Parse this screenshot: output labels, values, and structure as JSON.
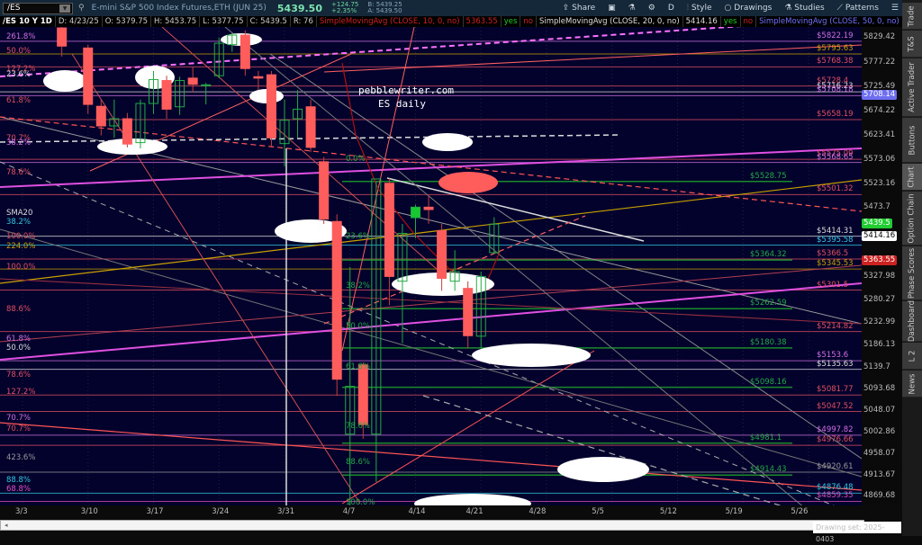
{
  "header": {
    "symbol": "/ES",
    "description": "E-mini S&P 500 Index Futures,ETH (JUN 25)",
    "last": "5439.50",
    "change": "+124.75",
    "change_pct": "+2.35%",
    "bid": "B: 5439.25",
    "ask": "A: 5439.50",
    "tools": {
      "share": "Share",
      "period": "D",
      "style": "Style",
      "drawings": "Drawings",
      "studies": "Studies",
      "patterns": "Patterns"
    }
  },
  "infobar": {
    "period": "/ES 10 Y 1D",
    "date": "D: 4/23/25",
    "open": "O: 5379.75",
    "high": "H: 5453.75",
    "low": "L: 5377.75",
    "close": "C: 5439.5",
    "range": "R: 76",
    "sma10": "SimpleMovingAvg (CLOSE, 10, 0, no)",
    "sma10_val": "5363.55",
    "sma20": "SimpleMovingAvg (CLOSE, 20, 0, no)",
    "sma20_val": "5414.16",
    "sma50": "SimpleMovingAvg (CLOSE, 50, 0, no)",
    "sma50_val": "...",
    "yes": "yes",
    "no": "no"
  },
  "watermark": {
    "line1": "pebblewriter.com",
    "line2": "ES daily"
  },
  "chart": {
    "candles": [
      {
        "i": 3,
        "o": 5850,
        "h": 5870,
        "l": 5790,
        "c": 5812
      },
      {
        "i": 5,
        "o": 5808,
        "h": 5815,
        "l": 5670,
        "c": 5690
      },
      {
        "i": 6,
        "o": 5686,
        "h": 5700,
        "l": 5625,
        "c": 5645
      },
      {
        "i": 7,
        "o": 5645,
        "h": 5700,
        "l": 5620,
        "c": 5660
      },
      {
        "i": 8,
        "o": 5660,
        "h": 5672,
        "l": 5600,
        "c": 5607
      },
      {
        "i": 9,
        "o": 5610,
        "h": 5700,
        "l": 5598,
        "c": 5692
      },
      {
        "i": 10,
        "o": 5692,
        "h": 5760,
        "l": 5670,
        "c": 5742
      },
      {
        "i": 11,
        "o": 5740,
        "h": 5750,
        "l": 5660,
        "c": 5680
      },
      {
        "i": 12,
        "o": 5685,
        "h": 5748,
        "l": 5668,
        "c": 5740
      },
      {
        "i": 13,
        "o": 5745,
        "h": 5768,
        "l": 5715,
        "c": 5732
      },
      {
        "i": 14,
        "o": 5729,
        "h": 5735,
        "l": 5690,
        "c": 5731
      },
      {
        "i": 15,
        "o": 5750,
        "h": 5830,
        "l": 5745,
        "c": 5818
      },
      {
        "i": 16,
        "o": 5815,
        "h": 5840,
        "l": 5800,
        "c": 5835
      },
      {
        "i": 17,
        "o": 5835,
        "h": 5845,
        "l": 5750,
        "c": 5765
      },
      {
        "i": 18,
        "o": 5748,
        "h": 5760,
        "l": 5720,
        "c": 5745
      },
      {
        "i": 19,
        "o": 5752,
        "h": 5760,
        "l": 5600,
        "c": 5620
      },
      {
        "i": 20,
        "o": 5608,
        "h": 5700,
        "l": 5560,
        "c": 5657
      },
      {
        "i": 21,
        "o": 5660,
        "h": 5720,
        "l": 5620,
        "c": 5680
      },
      {
        "i": 22,
        "o": 5685,
        "h": 5700,
        "l": 5590,
        "c": 5600
      },
      {
        "i": 23,
        "o": 5570,
        "h": 5580,
        "l": 5440,
        "c": 5450
      },
      {
        "i": 24,
        "o": 5445,
        "h": 5460,
        "l": 5080,
        "c": 5115
      },
      {
        "i": 25,
        "o": 5000,
        "h": 5350,
        "l": 4832,
        "c": 5100
      },
      {
        "i": 26,
        "o": 5145,
        "h": 5150,
        "l": 4990,
        "c": 5020
      },
      {
        "i": 27,
        "o": 5000,
        "h": 5530,
        "l": 4900,
        "c": 5534
      },
      {
        "i": 28,
        "o": 5525,
        "h": 5535,
        "l": 5270,
        "c": 5330
      },
      {
        "i": 29,
        "o": 5320,
        "h": 5440,
        "l": 5190,
        "c": 5420
      },
      {
        "i": 30,
        "o": 5453,
        "h": 5480,
        "l": 5410,
        "c": 5475,
        "filled": true
      },
      {
        "i": 31,
        "o": 5475,
        "h": 5500,
        "l": 5440,
        "c": 5470
      },
      {
        "i": 32,
        "o": 5426,
        "h": 5440,
        "l": 5300,
        "c": 5326
      },
      {
        "i": 33,
        "o": 5320,
        "h": 5385,
        "l": 5300,
        "c": 5340
      },
      {
        "i": 34,
        "o": 5305,
        "h": 5320,
        "l": 5180,
        "c": 5206
      },
      {
        "i": 35,
        "o": 5205,
        "h": 5340,
        "l": 5180,
        "c": 5330
      },
      {
        "i": 36,
        "o": 5379.75,
        "h": 5453.75,
        "l": 5377.75,
        "c": 5439.5
      }
    ],
    "price_levels": [
      {
        "text": "$5822.19",
        "p": 5822.19,
        "color": "#d070e0"
      },
      {
        "text": "$5795.63",
        "p": 5795.63,
        "color": "#c8a000"
      },
      {
        "text": "$5768.38",
        "p": 5768.38,
        "color": "#e05060"
      },
      {
        "text": "$5728.4",
        "p": 5728.4,
        "color": "#e05060"
      },
      {
        "text": "$5716.23",
        "p": 5716.23,
        "color": "#dddddd"
      },
      {
        "text": "$5708.18",
        "p": 5708.18,
        "color": "#d070e0"
      },
      {
        "text": "$5658.19",
        "p": 5658.19,
        "color": "#e05060"
      },
      {
        "text": "$5575.09",
        "p": 5575.09,
        "color": "#e05060"
      },
      {
        "text": "$5568.65",
        "p": 5568.65,
        "color": "#d070e0"
      },
      {
        "text": "$5501.32",
        "p": 5501.32,
        "color": "#e05060"
      },
      {
        "text": "$5414.31",
        "p": 5414.31,
        "color": "#dddddd"
      },
      {
        "text": "$5395.58",
        "p": 5395.58,
        "color": "#30c8e0"
      },
      {
        "text": "$5366.5",
        "p": 5366.5,
        "color": "#e05060"
      },
      {
        "text": "$5345.53",
        "p": 5345.53,
        "color": "#c8a000"
      },
      {
        "text": "$5301.5",
        "p": 5301.5,
        "color": "#e05060"
      },
      {
        "text": "$5214.82",
        "p": 5214.82,
        "color": "#e05060"
      },
      {
        "text": "$5153.6",
        "p": 5153.6,
        "color": "#d070e0"
      },
      {
        "text": "$5135.63",
        "p": 5135.63,
        "color": "#dddddd"
      },
      {
        "text": "$5081.77",
        "p": 5081.77,
        "color": "#e05060"
      },
      {
        "text": "$5047.52",
        "p": 5047.52,
        "color": "#e05060"
      },
      {
        "text": "$4997.82",
        "p": 4997.82,
        "color": "#d070e0"
      },
      {
        "text": "$4976.66",
        "p": 4976.66,
        "color": "#e05060"
      },
      {
        "text": "$4920.61",
        "p": 4920.61,
        "color": "#999999"
      },
      {
        "text": "$4876.48",
        "p": 4876.48,
        "color": "#30c8e0"
      },
      {
        "text": "$4859.35",
        "p": 4859.35,
        "color": "#e050c0"
      }
    ],
    "green_levels": [
      {
        "text": "$5528.75",
        "p": 5528.75
      },
      {
        "text": "$5364.32",
        "p": 5364.32
      },
      {
        "text": "$5262.59",
        "p": 5262.59
      },
      {
        "text": "$5180.38",
        "p": 5180.38
      },
      {
        "text": "$5098.16",
        "p": 5098.16
      },
      {
        "text": "$4981.1",
        "p": 4981.1
      },
      {
        "text": "$4914.43",
        "p": 4914.43
      }
    ],
    "fib_left": [
      {
        "text": "261.8%",
        "p": 5820,
        "color": "#d070e0"
      },
      {
        "text": "50.0%",
        "p": 5790,
        "color": "#e05060"
      },
      {
        "text": "127.2%",
        "p": 5752,
        "color": "#e05060"
      },
      {
        "text": "23.6%",
        "p": 5741,
        "color": "#dddddd"
      },
      {
        "text": "61.8%",
        "p": 5686,
        "color": "#e05060"
      },
      {
        "text": "70.7%",
        "p": 5607,
        "color": "#e05060"
      },
      {
        "text": "38.2%",
        "p": 5598,
        "color": "#d070e0"
      },
      {
        "text": "78.6%",
        "p": 5536,
        "color": "#e05060"
      },
      {
        "text": "SMA20",
        "p": 5452,
        "color": "#dddddd"
      },
      {
        "text": "38.2%",
        "p": 5432,
        "color": "#30c8e0"
      },
      {
        "text": "100.0%",
        "p": 5402,
        "color": "#e05060"
      },
      {
        "text": "224.0%",
        "p": 5381,
        "color": "#c8a000"
      },
      {
        "text": "100.0%",
        "p": 5338,
        "color": "#e05060"
      },
      {
        "text": "88.6%",
        "p": 5250,
        "color": "#e05060"
      },
      {
        "text": "61.8%",
        "p": 5188,
        "color": "#d070e0"
      },
      {
        "text": "50.0%",
        "p": 5169,
        "color": "#dddddd"
      },
      {
        "text": "78.6%",
        "p": 5113,
        "color": "#e05060"
      },
      {
        "text": "127.2%",
        "p": 5077,
        "color": "#e05060"
      },
      {
        "text": "70.7%",
        "p": 5022,
        "color": "#d070e0"
      },
      {
        "text": "70.7%",
        "p": 5000,
        "color": "#e05060"
      },
      {
        "text": "423.6%",
        "p": 4940,
        "color": "#999999"
      },
      {
        "text": "88.8%",
        "p": 4893,
        "color": "#30c8e0"
      },
      {
        "text": "68.8%",
        "p": 4874,
        "color": "#e050c0"
      }
    ],
    "fib_green": [
      {
        "text": "0.0%",
        "p": 5564
      },
      {
        "text": "23.6%",
        "p": 5402
      },
      {
        "text": "38.2%",
        "p": 5299
      },
      {
        "text": "50.0%",
        "p": 5214
      },
      {
        "text": "61.8%",
        "p": 5129
      },
      {
        "text": "78.6%",
        "p": 5005
      },
      {
        "text": "88.6%",
        "p": 4930
      },
      {
        "text": "100.0%",
        "p": 4845
      }
    ]
  },
  "axis": {
    "ticks": [
      5829.42,
      5777.22,
      5725.49,
      5674.22,
      5623.41,
      5573.06,
      5523.16,
      5473.7,
      5327.98,
      5280.27,
      5232.99,
      5186.13,
      5139.7,
      5093.68,
      5048.07,
      5002.86,
      4958.07,
      4913.67,
      4869.68
    ],
    "badges": [
      {
        "text": "5708.14",
        "p": 5708.14,
        "bg": "#6e6ef0",
        "fg": "#ffffff"
      },
      {
        "text": "5439.5",
        "p": 5439.5,
        "bg": "#22cc33",
        "fg": "#ffffff"
      },
      {
        "text": "5414.16",
        "p": 5414.16,
        "bg": "#ffffff",
        "fg": "#000000"
      },
      {
        "text": "5363.55",
        "p": 5363.55,
        "bg": "#cc2222",
        "fg": "#ffffff"
      }
    ]
  },
  "dates": [
    {
      "t": "3/3",
      "i": 0
    },
    {
      "t": "3/10",
      "i": 5
    },
    {
      "t": "3/17",
      "i": 10
    },
    {
      "t": "3/24",
      "i": 15
    },
    {
      "t": "3/31",
      "i": 20
    },
    {
      "t": "4/7",
      "i": 25
    },
    {
      "t": "4/14",
      "i": 30
    },
    {
      "t": "4/21",
      "i": 34.4
    },
    {
      "t": "4/28",
      "i": 39.2
    },
    {
      "t": "5/5",
      "i": 44
    },
    {
      "t": "5/12",
      "i": 49.2
    },
    {
      "t": "5/19",
      "i": 54.2
    },
    {
      "t": "5/26",
      "i": 59.2
    }
  ],
  "side_tabs": [
    "Trade",
    "T&S",
    "Active Trader",
    "Buttons",
    "Chart",
    "Option Chain",
    "Phase Scores",
    "Dashboard",
    "L 2",
    "News"
  ],
  "drawing_set": "Drawing set: 2025-0403"
}
